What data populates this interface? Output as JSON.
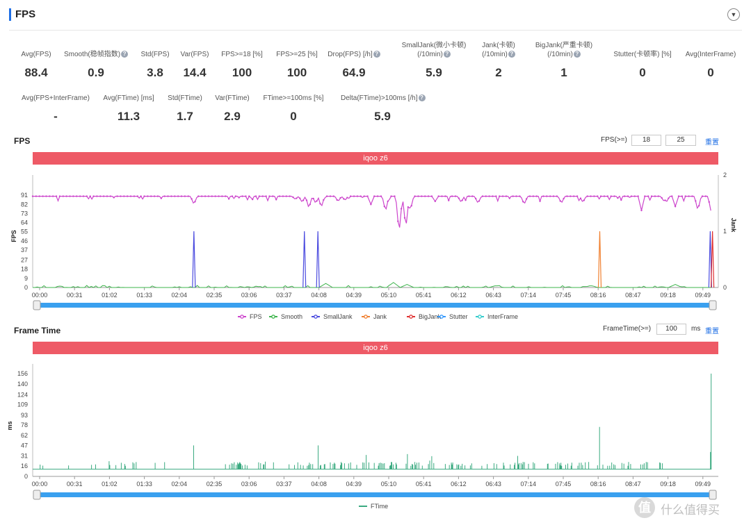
{
  "header": {
    "title": "FPS",
    "toggle_icon": "chevron-down-icon"
  },
  "stats_row1": [
    {
      "label": "Avg(FPS)",
      "value": "88.4",
      "help": false
    },
    {
      "label": "Smooth(稳帧指数)",
      "value": "0.9",
      "help": true
    },
    {
      "label": "Std(FPS)",
      "value": "3.8",
      "help": false
    },
    {
      "label": "Var(FPS)",
      "value": "14.4",
      "help": false
    },
    {
      "label": "FPS>=18 [%]",
      "value": "100",
      "help": false
    },
    {
      "label": "FPS>=25 [%]",
      "value": "100",
      "help": false
    },
    {
      "label": "Drop(FPS) [/h]",
      "value": "64.9",
      "help": true
    },
    {
      "label": "SmallJank(微小卡顿)",
      "label2": "(/10min)",
      "value": "5.9",
      "help": true
    },
    {
      "label": "Jank(卡顿)",
      "label2": "(/10min)",
      "value": "2",
      "help": true
    },
    {
      "label": "BigJank(严重卡顿)",
      "label2": "(/10min)",
      "value": "1",
      "help": true
    },
    {
      "label": "Stutter(卡顿率) [%]",
      "value": "0",
      "help": false
    },
    {
      "label": "Avg(InterFrame)",
      "value": "0",
      "help": false
    }
  ],
  "stats_row2": [
    {
      "label": "Avg(FPS+InterFrame)",
      "value": "-",
      "help": false
    },
    {
      "label": "Avg(FTime) [ms]",
      "value": "11.3",
      "help": false
    },
    {
      "label": "Std(FTime)",
      "value": "1.7",
      "help": false
    },
    {
      "label": "Var(FTime)",
      "value": "2.9",
      "help": false
    },
    {
      "label": "FTime>=100ms [%]",
      "value": "0",
      "help": false
    },
    {
      "label": "Delta(FTime)>100ms [/h]",
      "value": "5.9",
      "help": true
    }
  ],
  "fps_section": {
    "title": "FPS",
    "threshold_label": "FPS(>=)",
    "threshold_1": "18",
    "threshold_2": "25",
    "reset_label": "重置",
    "device_label": "iqoo z6"
  },
  "frametime_section": {
    "title": "Frame Time",
    "threshold_label": "FrameTime(>=)",
    "threshold_value": "100",
    "unit": "ms",
    "reset_label": "重置",
    "device_label": "iqoo z6"
  },
  "watermark": "什么值得买",
  "colors": {
    "fps": "#cc44cc",
    "smooth": "#3cb44b",
    "smalljank": "#4a4adf",
    "jank": "#f08030",
    "bigjank": "#e03030",
    "stutter": "#3399ff",
    "interframe": "#33cccc",
    "ftime": "#3aaa80",
    "scroll": "#3aa0ef",
    "red": "#ee5a66"
  },
  "chart_data": [
    {
      "type": "line",
      "title": "",
      "ylabel": "FPS",
      "y2label": "Jank",
      "ylim": [
        0,
        100
      ],
      "y2lim": [
        0,
        2
      ],
      "yticks": [
        "0",
        "9",
        "18",
        "27",
        "37",
        "46",
        "55",
        "64",
        "73",
        "82",
        "91"
      ],
      "y2ticks": [
        "0",
        "1",
        "2"
      ],
      "xticks": [
        "00:00",
        "00:31",
        "01:02",
        "01:33",
        "02:04",
        "02:35",
        "03:06",
        "03:37",
        "04:08",
        "04:39",
        "05:10",
        "05:41",
        "06:12",
        "06:43",
        "07:14",
        "07:45",
        "08:16",
        "08:47",
        "09:18",
        "09:49"
      ],
      "x_seconds_max": 602,
      "legend": [
        "FPS",
        "Smooth",
        "SmallJank",
        "Jank",
        "BigJank",
        "Stutter",
        "InterFrame"
      ],
      "series": [
        {
          "name": "FPS",
          "base": 90,
          "dips": [
            [
              143,
              82
            ],
            [
              233,
              87
            ],
            [
              239,
              84
            ],
            [
              245,
              78
            ],
            [
              251,
              83
            ],
            [
              256,
              79
            ],
            [
              271,
              85
            ],
            [
              277,
              86
            ],
            [
              300,
              82
            ],
            [
              313,
              75
            ],
            [
              325,
              53
            ],
            [
              331,
              58
            ],
            [
              335,
              76
            ],
            [
              357,
              85
            ],
            [
              380,
              84
            ],
            [
              395,
              83
            ],
            [
              436,
              82
            ],
            [
              469,
              83
            ],
            [
              488,
              84
            ],
            [
              540,
              76
            ],
            [
              560,
              85
            ],
            [
              562,
              84
            ],
            [
              570,
              80
            ],
            [
              590,
              76
            ],
            [
              602,
              73
            ]
          ]
        },
        {
          "name": "SmallJank",
          "spikes": [
            [
              143,
              1
            ],
            [
              241,
              1
            ],
            [
              253,
              1
            ],
            [
              601,
              1
            ]
          ]
        },
        {
          "name": "Jank",
          "spikes": [
            [
              503,
              1
            ]
          ]
        },
        {
          "name": "BigJank",
          "spikes": [
            [
              603,
              1
            ]
          ]
        },
        {
          "name": "Smooth",
          "base": 0,
          "bumps": [
            [
              260,
              4
            ],
            [
              320,
              5
            ],
            [
              332,
              3
            ],
            [
              411,
              2
            ],
            [
              495,
              2
            ],
            [
              570,
              3
            ]
          ]
        }
      ]
    },
    {
      "type": "bar",
      "title": "",
      "ylabel": "ms",
      "ylim": [
        0,
        156
      ],
      "yticks": [
        "0",
        "16",
        "31",
        "47",
        "62",
        "78",
        "93",
        "109",
        "124",
        "140",
        "156"
      ],
      "xticks": [
        "00:00",
        "00:31",
        "01:02",
        "01:33",
        "02:04",
        "02:35",
        "03:06",
        "03:37",
        "04:08",
        "04:39",
        "05:10",
        "05:41",
        "06:12",
        "06:43",
        "07:14",
        "07:45",
        "08:16",
        "08:47",
        "09:18",
        "09:49"
      ],
      "x_seconds_max": 602,
      "legend": [
        "FTime"
      ],
      "series": [
        {
          "name": "FTime",
          "base": 11,
          "spikes": [
            [
              143,
              47
            ],
            [
              253,
              47
            ],
            [
              503,
              75
            ],
            [
              601,
              37
            ],
            [
              602,
              156
            ]
          ]
        }
      ]
    }
  ]
}
